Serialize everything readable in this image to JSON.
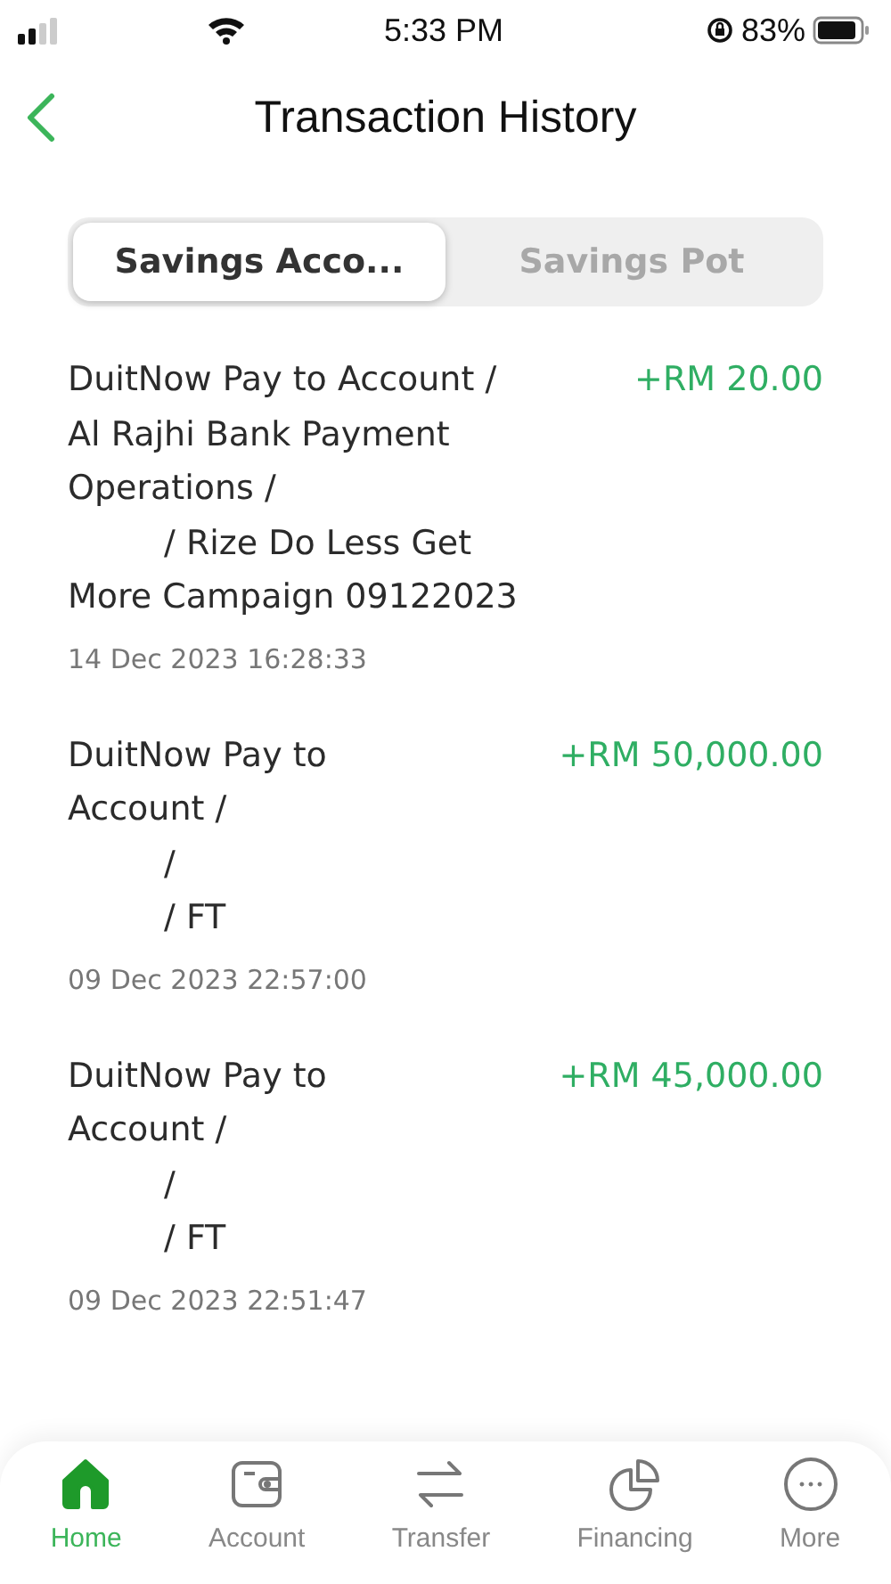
{
  "status_bar": {
    "time": "5:33 PM",
    "battery": "83%"
  },
  "header": {
    "title": "Transaction History"
  },
  "segments": [
    {
      "label": "Savings Acco...",
      "selected": true
    },
    {
      "label": "Savings Pot",
      "selected": false
    }
  ],
  "transactions": [
    {
      "lines": [
        {
          "text": "DuitNow Pay to Account /",
          "indented": false
        },
        {
          "text": "Al Rajhi Bank Payment",
          "indented": false
        },
        {
          "text": "Operations /",
          "indented": false
        },
        {
          "text": "/ Rize Do Less Get",
          "indented": true
        },
        {
          "text": "More Campaign 09122023",
          "indented": false
        }
      ],
      "amount": "+RM 20.00",
      "date": "14 Dec 2023 16:28:33"
    },
    {
      "lines": [
        {
          "text": "DuitNow Pay to",
          "indented": false
        },
        {
          "text": "Account /",
          "indented": false
        },
        {
          "text": "/",
          "indented": true
        },
        {
          "text": "/ FT",
          "indented": true
        }
      ],
      "amount": "+RM 50,000.00",
      "date": "09 Dec 2023 22:57:00"
    },
    {
      "lines": [
        {
          "text": "DuitNow Pay to",
          "indented": false
        },
        {
          "text": "Account /",
          "indented": false
        },
        {
          "text": "/",
          "indented": true
        },
        {
          "text": "/ FT",
          "indented": true
        }
      ],
      "amount": "+RM 45,000.00",
      "date": "09 Dec 2023 22:51:47"
    }
  ],
  "tab_bar": [
    {
      "kind": "home",
      "label": "Home",
      "selected": true
    },
    {
      "kind": "account",
      "label": "Account",
      "selected": false
    },
    {
      "kind": "transfer",
      "label": "Transfer",
      "selected": false
    },
    {
      "kind": "financing",
      "label": "Financing",
      "selected": false
    },
    {
      "kind": "more",
      "label": "More",
      "selected": false
    }
  ]
}
